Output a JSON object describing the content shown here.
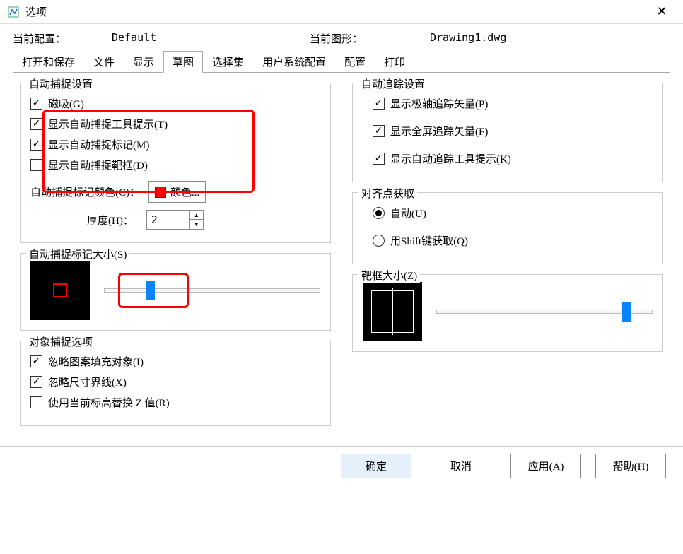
{
  "window": {
    "title": "选项"
  },
  "info": {
    "profile_label": "当前配置：",
    "profile_value": "Default",
    "drawing_label": "当前图形：",
    "drawing_value": "Drawing1.dwg"
  },
  "tabs": {
    "items": [
      "打开和保存",
      "文件",
      "显示",
      "草图",
      "选择集",
      "用户系统配置",
      "配置",
      "打印"
    ],
    "active": "草图"
  },
  "autosnap": {
    "title": "自动捕捉设置",
    "magnet": "磁吸(G)",
    "tooltip": "显示自动捕捉工具提示(T)",
    "marker": "显示自动捕捉标记(M)",
    "aperture": "显示自动捕捉靶框(D)",
    "color_label": "自动捕捉标记颜色(C)：",
    "color_btn": "颜色...",
    "color_value": "#ff0000",
    "thickness_label": "厚度(H)：",
    "thickness_value": "2"
  },
  "autotrack": {
    "title": "自动追踪设置",
    "polar": "显示极轴追踪矢量(P)",
    "fullscreen": "显示全屏追踪矢量(F)",
    "tooltip": "显示自动追踪工具提示(K)"
  },
  "align": {
    "title": "对齐点获取",
    "auto": "自动(U)",
    "shift": "用Shift键获取(Q)"
  },
  "marker_size": {
    "title": "自动捕捉标记大小(S)",
    "value": 20
  },
  "aperture_size": {
    "title": "靶框大小(Z)",
    "value": 88
  },
  "osnap_opts": {
    "title": "对象捕捉选项",
    "hatch": "忽略图案填充对象(I)",
    "dim": "忽略尺寸界线(X)",
    "zreplace": "使用当前标高替换 Z 值(R)"
  },
  "buttons": {
    "ok": "确定",
    "cancel": "取消",
    "apply": "应用(A)",
    "help": "帮助(H)"
  }
}
